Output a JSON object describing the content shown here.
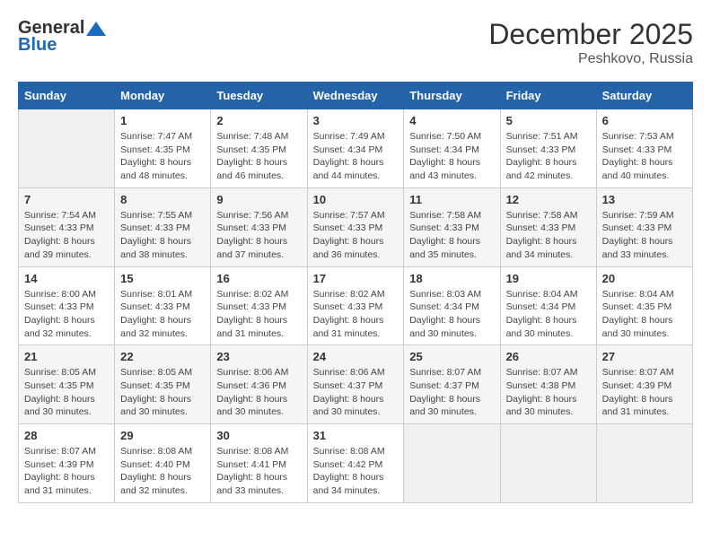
{
  "header": {
    "logo_general": "General",
    "logo_blue": "Blue",
    "month_title": "December 2025",
    "location": "Peshkovo, Russia"
  },
  "weekdays": [
    "Sunday",
    "Monday",
    "Tuesday",
    "Wednesday",
    "Thursday",
    "Friday",
    "Saturday"
  ],
  "weeks": [
    [
      {
        "day": "",
        "sunrise": "",
        "sunset": "",
        "daylight": ""
      },
      {
        "day": "1",
        "sunrise": "Sunrise: 7:47 AM",
        "sunset": "Sunset: 4:35 PM",
        "daylight": "Daylight: 8 hours and 48 minutes."
      },
      {
        "day": "2",
        "sunrise": "Sunrise: 7:48 AM",
        "sunset": "Sunset: 4:35 PM",
        "daylight": "Daylight: 8 hours and 46 minutes."
      },
      {
        "day": "3",
        "sunrise": "Sunrise: 7:49 AM",
        "sunset": "Sunset: 4:34 PM",
        "daylight": "Daylight: 8 hours and 44 minutes."
      },
      {
        "day": "4",
        "sunrise": "Sunrise: 7:50 AM",
        "sunset": "Sunset: 4:34 PM",
        "daylight": "Daylight: 8 hours and 43 minutes."
      },
      {
        "day": "5",
        "sunrise": "Sunrise: 7:51 AM",
        "sunset": "Sunset: 4:33 PM",
        "daylight": "Daylight: 8 hours and 42 minutes."
      },
      {
        "day": "6",
        "sunrise": "Sunrise: 7:53 AM",
        "sunset": "Sunset: 4:33 PM",
        "daylight": "Daylight: 8 hours and 40 minutes."
      }
    ],
    [
      {
        "day": "7",
        "sunrise": "Sunrise: 7:54 AM",
        "sunset": "Sunset: 4:33 PM",
        "daylight": "Daylight: 8 hours and 39 minutes."
      },
      {
        "day": "8",
        "sunrise": "Sunrise: 7:55 AM",
        "sunset": "Sunset: 4:33 PM",
        "daylight": "Daylight: 8 hours and 38 minutes."
      },
      {
        "day": "9",
        "sunrise": "Sunrise: 7:56 AM",
        "sunset": "Sunset: 4:33 PM",
        "daylight": "Daylight: 8 hours and 37 minutes."
      },
      {
        "day": "10",
        "sunrise": "Sunrise: 7:57 AM",
        "sunset": "Sunset: 4:33 PM",
        "daylight": "Daylight: 8 hours and 36 minutes."
      },
      {
        "day": "11",
        "sunrise": "Sunrise: 7:58 AM",
        "sunset": "Sunset: 4:33 PM",
        "daylight": "Daylight: 8 hours and 35 minutes."
      },
      {
        "day": "12",
        "sunrise": "Sunrise: 7:58 AM",
        "sunset": "Sunset: 4:33 PM",
        "daylight": "Daylight: 8 hours and 34 minutes."
      },
      {
        "day": "13",
        "sunrise": "Sunrise: 7:59 AM",
        "sunset": "Sunset: 4:33 PM",
        "daylight": "Daylight: 8 hours and 33 minutes."
      }
    ],
    [
      {
        "day": "14",
        "sunrise": "Sunrise: 8:00 AM",
        "sunset": "Sunset: 4:33 PM",
        "daylight": "Daylight: 8 hours and 32 minutes."
      },
      {
        "day": "15",
        "sunrise": "Sunrise: 8:01 AM",
        "sunset": "Sunset: 4:33 PM",
        "daylight": "Daylight: 8 hours and 32 minutes."
      },
      {
        "day": "16",
        "sunrise": "Sunrise: 8:02 AM",
        "sunset": "Sunset: 4:33 PM",
        "daylight": "Daylight: 8 hours and 31 minutes."
      },
      {
        "day": "17",
        "sunrise": "Sunrise: 8:02 AM",
        "sunset": "Sunset: 4:33 PM",
        "daylight": "Daylight: 8 hours and 31 minutes."
      },
      {
        "day": "18",
        "sunrise": "Sunrise: 8:03 AM",
        "sunset": "Sunset: 4:34 PM",
        "daylight": "Daylight: 8 hours and 30 minutes."
      },
      {
        "day": "19",
        "sunrise": "Sunrise: 8:04 AM",
        "sunset": "Sunset: 4:34 PM",
        "daylight": "Daylight: 8 hours and 30 minutes."
      },
      {
        "day": "20",
        "sunrise": "Sunrise: 8:04 AM",
        "sunset": "Sunset: 4:35 PM",
        "daylight": "Daylight: 8 hours and 30 minutes."
      }
    ],
    [
      {
        "day": "21",
        "sunrise": "Sunrise: 8:05 AM",
        "sunset": "Sunset: 4:35 PM",
        "daylight": "Daylight: 8 hours and 30 minutes."
      },
      {
        "day": "22",
        "sunrise": "Sunrise: 8:05 AM",
        "sunset": "Sunset: 4:35 PM",
        "daylight": "Daylight: 8 hours and 30 minutes."
      },
      {
        "day": "23",
        "sunrise": "Sunrise: 8:06 AM",
        "sunset": "Sunset: 4:36 PM",
        "daylight": "Daylight: 8 hours and 30 minutes."
      },
      {
        "day": "24",
        "sunrise": "Sunrise: 8:06 AM",
        "sunset": "Sunset: 4:37 PM",
        "daylight": "Daylight: 8 hours and 30 minutes."
      },
      {
        "day": "25",
        "sunrise": "Sunrise: 8:07 AM",
        "sunset": "Sunset: 4:37 PM",
        "daylight": "Daylight: 8 hours and 30 minutes."
      },
      {
        "day": "26",
        "sunrise": "Sunrise: 8:07 AM",
        "sunset": "Sunset: 4:38 PM",
        "daylight": "Daylight: 8 hours and 30 minutes."
      },
      {
        "day": "27",
        "sunrise": "Sunrise: 8:07 AM",
        "sunset": "Sunset: 4:39 PM",
        "daylight": "Daylight: 8 hours and 31 minutes."
      }
    ],
    [
      {
        "day": "28",
        "sunrise": "Sunrise: 8:07 AM",
        "sunset": "Sunset: 4:39 PM",
        "daylight": "Daylight: 8 hours and 31 minutes."
      },
      {
        "day": "29",
        "sunrise": "Sunrise: 8:08 AM",
        "sunset": "Sunset: 4:40 PM",
        "daylight": "Daylight: 8 hours and 32 minutes."
      },
      {
        "day": "30",
        "sunrise": "Sunrise: 8:08 AM",
        "sunset": "Sunset: 4:41 PM",
        "daylight": "Daylight: 8 hours and 33 minutes."
      },
      {
        "day": "31",
        "sunrise": "Sunrise: 8:08 AM",
        "sunset": "Sunset: 4:42 PM",
        "daylight": "Daylight: 8 hours and 34 minutes."
      },
      {
        "day": "",
        "sunrise": "",
        "sunset": "",
        "daylight": ""
      },
      {
        "day": "",
        "sunrise": "",
        "sunset": "",
        "daylight": ""
      },
      {
        "day": "",
        "sunrise": "",
        "sunset": "",
        "daylight": ""
      }
    ]
  ]
}
